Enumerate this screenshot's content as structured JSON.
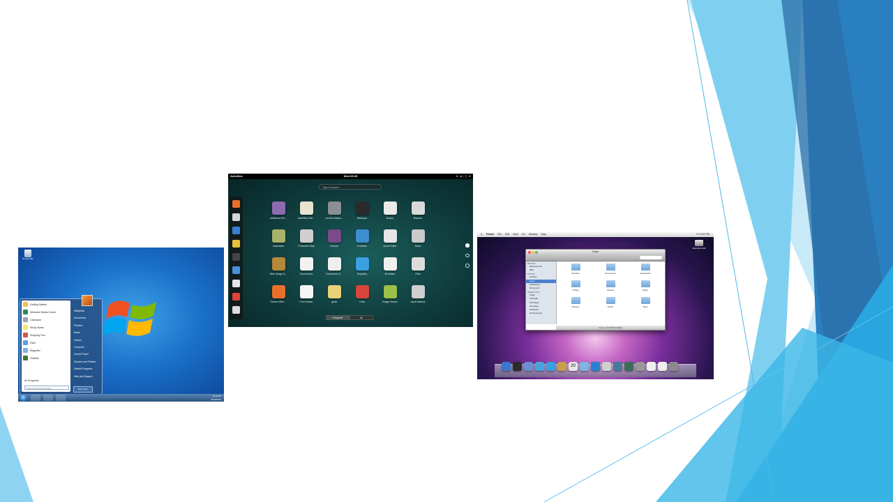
{
  "win7": {
    "recycle_bin": "Recycle Bin",
    "start_menu": {
      "left_items": [
        {
          "label": "Getting Started",
          "color": "#f2c14e"
        },
        {
          "label": "Windows Media Center",
          "color": "#2e8b57"
        },
        {
          "label": "Calculator",
          "color": "#9aa4ad"
        },
        {
          "label": "Sticky Notes",
          "color": "#f5e66b"
        },
        {
          "label": "Snipping Tool",
          "color": "#d9534f"
        },
        {
          "label": "Paint",
          "color": "#5aa0e6"
        },
        {
          "label": "Magnifier",
          "color": "#7fb0e0"
        },
        {
          "label": "Solitaire",
          "color": "#3a7a3a"
        }
      ],
      "all_programs": "All Programs",
      "search_placeholder": "Search programs and files",
      "right_items": [
        "Wikipedia",
        "Documents",
        "Pictures",
        "Music",
        "Games",
        "Computer",
        "Control Panel",
        "Devices and Printers",
        "Default Programs",
        "Help and Support"
      ],
      "shutdown": "Shut down"
    },
    "clock": {
      "time": "10:11 PM",
      "date": "01/23/2013"
    }
  },
  "gnome": {
    "activities": "Activities",
    "clock": "Wed 09:25",
    "tray": "▾ ◂) ▯ ▾",
    "search_placeholder": "Type to search...",
    "apps": [
      {
        "label": "Additional Dri...",
        "color": "#8c6bb1"
      },
      {
        "label": "AisleRiot Soli...",
        "color": "#e8e2d0"
      },
      {
        "label": "Archive Mana...",
        "color": "#8a8f93"
      },
      {
        "label": "Backups",
        "color": "#2b2b2b"
      },
      {
        "label": "Books",
        "color": "#e9e9e9"
      },
      {
        "label": "Brasero",
        "color": "#d9d9d9"
      },
      {
        "label": "",
        "color": "transparent"
      },
      {
        "label": "Calculator",
        "color": "#a7b26a"
      },
      {
        "label": "Character Map",
        "color": "#cfcfcf"
      },
      {
        "label": "Cheese",
        "color": "#7a4a8a"
      },
      {
        "label": "Contacts",
        "color": "#3d8fd1"
      },
      {
        "label": "dconf Editor",
        "color": "#e6e6e6"
      },
      {
        "label": "Disks",
        "color": "#c9c9c9"
      },
      {
        "label": "",
        "color": "transparent"
      },
      {
        "label": "Disk Usage A...",
        "color": "#b5893a"
      },
      {
        "label": "Documents",
        "color": "#f2f2f2"
      },
      {
        "label": "Document Vi...",
        "color": "#efefef"
      },
      {
        "label": "Empathy",
        "color": "#3aa0e0"
      },
      {
        "label": "Evolution",
        "color": "#f0f0f0"
      },
      {
        "label": "Files",
        "color": "#dcdcdc"
      },
      {
        "label": "",
        "color": "transparent"
      },
      {
        "label": "Firefox Web ...",
        "color": "#e8702a"
      },
      {
        "label": "Font Viewer",
        "color": "#f5f5f5"
      },
      {
        "label": "gedit",
        "color": "#e9d27a"
      },
      {
        "label": "Help",
        "color": "#d8453b"
      },
      {
        "label": "Image Viewer",
        "color": "#9bbf4a"
      },
      {
        "label": "Input Method",
        "color": "#cfcfcf"
      },
      {
        "label": "",
        "color": "transparent"
      }
    ],
    "dash_colors": [
      "#e8702a",
      "#d6d6d6",
      "#3a7fd1",
      "#e6c23a",
      "#444444",
      "#4a90d9",
      "#e6e6e6",
      "#d8453b",
      "#dddddd"
    ],
    "switch": {
      "frequent": "Frequent",
      "all": "All"
    }
  },
  "mac": {
    "menu": [
      "Finder",
      "File",
      "Edit",
      "View",
      "Go",
      "Window",
      "Help"
    ],
    "menu_time": "Fri 9:52 PM",
    "hd_label": "Macintosh HD",
    "finder": {
      "title": "Guest",
      "sidebar": [
        {
          "head": "DEVICES",
          "items": [
            "Macintosh HD",
            "iDisk"
          ]
        },
        {
          "head": "PLACES",
          "items": [
            "Desktop",
            "Guest",
            "Applications",
            "Documents"
          ]
        },
        {
          "head": "SEARCH FOR",
          "items": [
            "Today",
            "Yesterday",
            "Past Week",
            "All Images",
            "All Movies",
            "All Documents"
          ]
        }
      ],
      "selected": "Guest",
      "folders": [
        "Desktop",
        "Documents",
        "Downloads",
        "Library",
        "Movies",
        "Music",
        "Pictures",
        "Public",
        "Sites"
      ],
      "status": "9 items, 11.98 GB available"
    },
    "dock_colors": [
      "#3b77d1",
      "#2c2c2c",
      "#6b8fd0",
      "#4aa3df",
      "#3aa0e0",
      "#c9a04a",
      "#e8e8e8",
      "#7fb4e6",
      "#2c7fd0",
      "#cfcfcf",
      "#4a7a9a",
      "#3b6e5a",
      "#999999",
      "#f0f0f0",
      "#eeeeee",
      "#8a8a8a"
    ],
    "dock_calendar": "20"
  }
}
